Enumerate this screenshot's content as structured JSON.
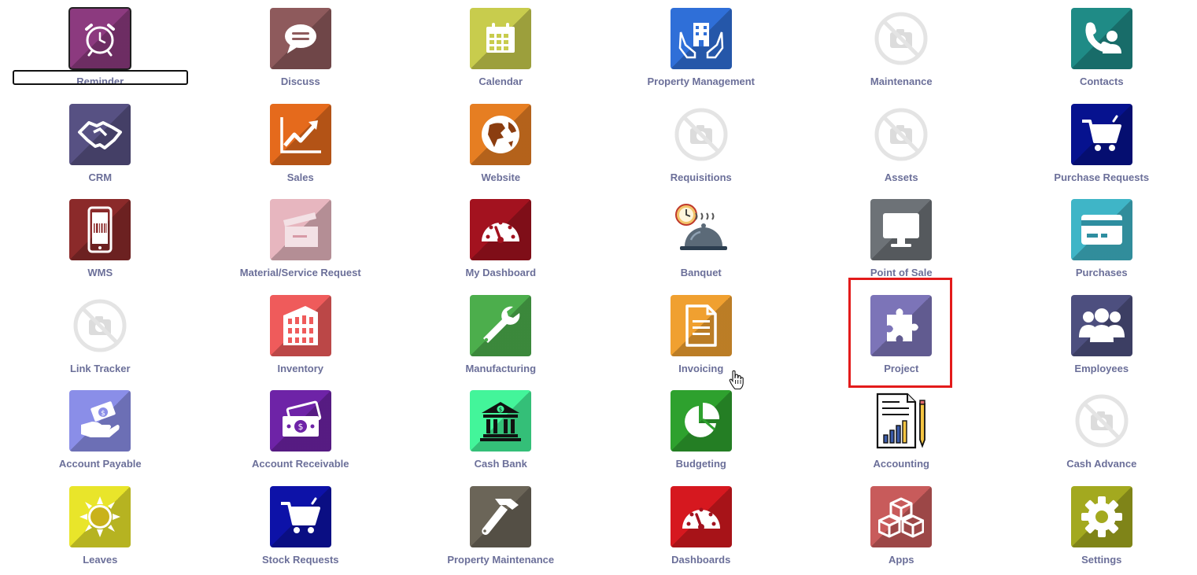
{
  "apps": [
    {
      "label": "Reminder",
      "icon": "alarm-clock-icon",
      "color": "#8c3a7f"
    },
    {
      "label": "Discuss",
      "icon": "chat-bubble-icon",
      "color": "#8e5a5c"
    },
    {
      "label": "Calendar",
      "icon": "calendar-icon",
      "color": "#c8cc4d"
    },
    {
      "label": "Property Management",
      "icon": "building-hands-icon",
      "color": "#2f6fd8"
    },
    {
      "label": "Maintenance",
      "icon": "no-image-icon",
      "color": ""
    },
    {
      "label": "Contacts",
      "icon": "contact-phone-icon",
      "color": "#1f8b86"
    },
    {
      "label": "CRM",
      "icon": "handshake-icon",
      "color": "#575183"
    },
    {
      "label": "Sales",
      "icon": "chart-up-icon",
      "color": "#e56a1c"
    },
    {
      "label": "Website",
      "icon": "globe-icon",
      "color": "#e67e22"
    },
    {
      "label": "Requisitions",
      "icon": "no-image-icon",
      "color": ""
    },
    {
      "label": "Assets",
      "icon": "no-image-icon",
      "color": ""
    },
    {
      "label": "Purchase Requests",
      "icon": "cart-icon",
      "color": "#06128f"
    },
    {
      "label": "WMS",
      "icon": "phone-barcode-icon",
      "color": "#8b2a2a"
    },
    {
      "label": "Material/Service Request",
      "icon": "clapper-icon",
      "color": "#e7b6bf"
    },
    {
      "label": "My Dashboard",
      "icon": "gauge-icon",
      "color": "#a3121f"
    },
    {
      "label": "Banquet",
      "icon": "cloche-icon",
      "color": ""
    },
    {
      "label": "Point of Sale",
      "icon": "monitor-icon",
      "color": "#6d7277"
    },
    {
      "label": "Purchases",
      "icon": "credit-card-icon",
      "color": "#3fb5c7"
    },
    {
      "label": "Link Tracker",
      "icon": "no-image-icon",
      "color": ""
    },
    {
      "label": "Inventory",
      "icon": "warehouse-icon",
      "color": "#ef5b5b"
    },
    {
      "label": "Manufacturing",
      "icon": "wrench-icon",
      "color": "#4cae4c"
    },
    {
      "label": "Invoicing",
      "icon": "document-icon",
      "color": "#f0a030"
    },
    {
      "label": "Project",
      "icon": "puzzle-icon",
      "color": "#7c74b8"
    },
    {
      "label": "Employees",
      "icon": "people-icon",
      "color": "#4d4f7f"
    },
    {
      "label": "Account Payable",
      "icon": "hand-money-icon",
      "color": "#8a8ee8"
    },
    {
      "label": "Account Receivable",
      "icon": "cash-icon",
      "color": "#6e23a7"
    },
    {
      "label": "Cash Bank",
      "icon": "bank-icon",
      "color": "#43f59a"
    },
    {
      "label": "Budgeting",
      "icon": "pie-chart-icon",
      "color": "#2ea12e"
    },
    {
      "label": "Accounting",
      "icon": "report-pencil-icon",
      "color": ""
    },
    {
      "label": "Cash Advance",
      "icon": "no-image-icon",
      "color": ""
    },
    {
      "label": "Leaves",
      "icon": "sun-icon",
      "color": "#e9e52a"
    },
    {
      "label": "Stock Requests",
      "icon": "cart-icon",
      "color": "#0d12a8"
    },
    {
      "label": "Property Maintenance",
      "icon": "hammer-icon",
      "color": "#6b6558"
    },
    {
      "label": "Dashboards",
      "icon": "gauge-icon",
      "color": "#d6181f"
    },
    {
      "label": "Apps",
      "icon": "cubes-icon",
      "color": "#c85b5b"
    },
    {
      "label": "Settings",
      "icon": "gear-icon",
      "color": "#a3a91f"
    }
  ]
}
